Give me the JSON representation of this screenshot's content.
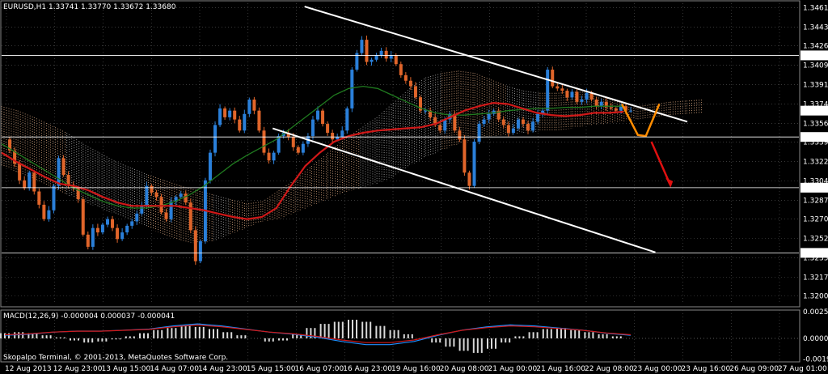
{
  "terminal": {
    "symbol_header": "EURUSD,H1  1.33741 1.33770 1.33672 1.33680",
    "indicator_header": "MACD(12,26,9) -0.000004 0.000037 -0.000041",
    "copyright": "Skopalpo Terminal, © 2001-2013, MetaQuotes Software Corp."
  },
  "colors": {
    "background": "#000000",
    "grid": "#5a5a5a",
    "bull_candle": "#2a7fd9",
    "bear_candle": "#e0652a",
    "ma_fast": "#d01818",
    "ma_slow": "#1f7a1f",
    "cloud_a": "#e9b48a",
    "cloud_b": "#bfbfbf",
    "trend_line": "#ffffff",
    "projection": "#ff8c00",
    "arrow": "#e01010",
    "macd_signal_up": "#1e90ff",
    "macd_signal_dn": "#d01818",
    "macd_hist": "#d8d8d8"
  },
  "chart_data": {
    "type": "candlestick",
    "ylim": [
      1.3193,
      1.3465
    ],
    "x_labels": [
      "12 Aug 2013",
      "12 Aug 23:00",
      "13 Aug 15:00",
      "14 Aug 07:00",
      "14 Aug 23:00",
      "15 Aug 15:00",
      "16 Aug 07:00",
      "16 Aug 23:00",
      "19 Aug 16:00",
      "20 Aug 08:00",
      "21 Aug 00:00",
      "21 Aug 16:00",
      "22 Aug 08:00",
      "23 Aug 00:00",
      "23 Aug 16:00",
      "26 Aug 09:00",
      "27 Aug 01:00"
    ],
    "y_ticks": [
      1.3461,
      1.34435,
      1.34265,
      1.3409,
      1.33915,
      1.3374,
      1.33565,
      1.33395,
      1.3322,
      1.33045,
      1.3287,
      1.327,
      1.32525,
      1.3235,
      1.32175,
      1.32005
    ],
    "y_ticks_text": [
      "1.34610",
      "1.34435",
      "1.34265",
      "1.34090",
      "1.33915",
      "1.33740",
      "1.33565",
      "1.33395",
      "1.33220",
      "1.33045",
      "1.32870",
      "1.32700",
      "1.32525",
      "1.32350",
      "1.32175",
      "1.32005"
    ],
    "price_levels": [
      {
        "value": 1.34179,
        "label": "1.34179"
      },
      {
        "value": 1.33442,
        "label": "1.33442"
      },
      {
        "value": 1.32984,
        "label": "1.32984"
      },
      {
        "value": 1.32395,
        "label": "1.32395"
      }
    ],
    "current_price": {
      "value": 1.3368,
      "label": "1.33680"
    },
    "close_path": [
      1.3342,
      1.3332,
      1.332,
      1.3305,
      1.3298,
      1.3312,
      1.3295,
      1.3283,
      1.327,
      1.3278,
      1.33,
      1.3325,
      1.331,
      1.33,
      1.3298,
      1.3288,
      1.3256,
      1.3245,
      1.3262,
      1.3258,
      1.3265,
      1.327,
      1.3262,
      1.3252,
      1.3258,
      1.3264,
      1.3268,
      1.3275,
      1.3282,
      1.33,
      1.3294,
      1.329,
      1.3276,
      1.327,
      1.3286,
      1.329,
      1.3293,
      1.3285,
      1.326,
      1.3232,
      1.325,
      1.3305,
      1.333,
      1.3355,
      1.337,
      1.3362,
      1.3368,
      1.336,
      1.335,
      1.3365,
      1.3378,
      1.3368,
      1.335,
      1.333,
      1.3323,
      1.333,
      1.3345,
      1.3348,
      1.3344,
      1.3335,
      1.333,
      1.3338,
      1.3345,
      1.336,
      1.3368,
      1.3356,
      1.3348,
      1.3342,
      1.3344,
      1.335,
      1.337,
      1.3405,
      1.342,
      1.3432,
      1.3412,
      1.3414,
      1.3418,
      1.3422,
      1.3415,
      1.3418,
      1.341,
      1.34,
      1.3395,
      1.339,
      1.338,
      1.3368,
      1.3368,
      1.3362,
      1.3355,
      1.335,
      1.336,
      1.3365,
      1.335,
      1.3342,
      1.3312,
      1.33,
      1.334,
      1.3356,
      1.336,
      1.3365,
      1.3368,
      1.336,
      1.3355,
      1.3348,
      1.3352,
      1.336,
      1.3356,
      1.335,
      1.3358,
      1.3365,
      1.3368,
      1.3405,
      1.339,
      1.3388,
      1.3386,
      1.338,
      1.3385,
      1.3376,
      1.3378,
      1.3384,
      1.3378,
      1.3372,
      1.3376,
      1.3371,
      1.337,
      1.3368,
      1.3372,
      1.3368,
      1.3368
    ],
    "ma_fast_path": [
      1.333,
      1.3322,
      1.3315,
      1.3308,
      1.3302,
      1.33,
      1.3296,
      1.329,
      1.3285,
      1.3282,
      1.3282,
      1.3282,
      1.3282,
      1.328,
      1.3278,
      1.3275,
      1.3272,
      1.327,
      1.3272,
      1.328,
      1.33,
      1.3318,
      1.333,
      1.334,
      1.3345,
      1.3348,
      1.335,
      1.3351,
      1.3352,
      1.3353,
      1.3356,
      1.3362,
      1.3368,
      1.3372,
      1.3375,
      1.3374,
      1.337,
      1.3366,
      1.3364,
      1.3363,
      1.3364,
      1.3366,
      1.3366,
      1.3367
    ],
    "ma_slow_path": [
      1.3338,
      1.333,
      1.3322,
      1.3314,
      1.3306,
      1.3298,
      1.3292,
      1.3286,
      1.3282,
      1.328,
      1.328,
      1.3282,
      1.3286,
      1.3292,
      1.33,
      1.331,
      1.332,
      1.3328,
      1.3335,
      1.3342,
      1.3352,
      1.3362,
      1.3372,
      1.3382,
      1.3388,
      1.339,
      1.3388,
      1.3382,
      1.3376,
      1.337,
      1.3366,
      1.3364,
      1.3364,
      1.3365,
      1.3366,
      1.3368,
      1.3369,
      1.337,
      1.337,
      1.3371,
      1.3371,
      1.3372,
      1.3372,
      1.3372
    ],
    "cloud_top_path": [
      1.3372,
      1.3368,
      1.3362,
      1.3355,
      1.3348,
      1.3338,
      1.333,
      1.3322,
      1.3316,
      1.331,
      1.3305,
      1.33,
      1.3296,
      1.3292,
      1.3288,
      1.3284,
      1.3286,
      1.3296,
      1.3306,
      1.3318,
      1.333,
      1.3342,
      1.3352,
      1.3362,
      1.3375,
      1.3388,
      1.3398,
      1.3402,
      1.3404,
      1.3402,
      1.3396,
      1.339,
      1.3386,
      1.3384,
      1.3384,
      1.3385,
      1.3385,
      1.338,
      1.3375,
      1.3372,
      1.3374,
      1.3376,
      1.3377,
      1.3378
    ],
    "cloud_bot_path": [
      1.3318,
      1.3312,
      1.3306,
      1.3298,
      1.3292,
      1.3286,
      1.328,
      1.3274,
      1.3268,
      1.3262,
      1.3256,
      1.325,
      1.3248,
      1.325,
      1.3256,
      1.3262,
      1.3268,
      1.327,
      1.3276,
      1.3282,
      1.3288,
      1.3294,
      1.3298,
      1.3302,
      1.3308,
      1.3318,
      1.3326,
      1.3332,
      1.3338,
      1.3342,
      1.3345,
      1.3346,
      1.3348,
      1.3349,
      1.335,
      1.3352,
      1.3355,
      1.3356,
      1.3358,
      1.336,
      1.3362,
      1.3364,
      1.3365,
      1.3366
    ],
    "macd_hist": [
      0.0005,
      0.0006,
      0.0005,
      0.0003,
      0.0001,
      -0.0002,
      -0.0004,
      -0.0003,
      -0.0001,
      0.0002,
      0.0005,
      0.0008,
      0.001,
      0.0012,
      0.0011,
      0.0009,
      0.0006,
      0.0003,
      0.0,
      -0.0003,
      -0.0002,
      0.0004,
      0.001,
      0.0014,
      0.0016,
      0.0018,
      0.0016,
      0.0012,
      0.0008,
      0.0004,
      0.0,
      -0.0004,
      -0.0008,
      -0.0012,
      -0.0014,
      -0.001,
      -0.0004,
      0.0002,
      0.0006,
      0.0009,
      0.001,
      0.0008,
      0.0006,
      0.0004,
      0.0002,
      0.0
    ],
    "macd_signal_path": [
      0.0003,
      0.0004,
      0.0006,
      0.0007,
      0.0007,
      0.0008,
      0.0009,
      0.0012,
      0.0014,
      0.0012,
      0.0009,
      0.0006,
      0.0004,
      0.0001,
      -0.0003,
      -0.0006,
      -0.0006,
      -0.0003,
      0.0003,
      0.0008,
      0.0011,
      0.0013,
      0.0012,
      0.001,
      0.0008,
      0.0005,
      0.0003
    ]
  },
  "annotations": {
    "upper_channel": {
      "from": [
        0.38,
        1.3462
      ],
      "to": [
        0.86,
        1.3358
      ]
    },
    "lower_channel": {
      "from": [
        0.34,
        1.3352
      ],
      "to": [
        0.82,
        1.324
      ]
    }
  }
}
